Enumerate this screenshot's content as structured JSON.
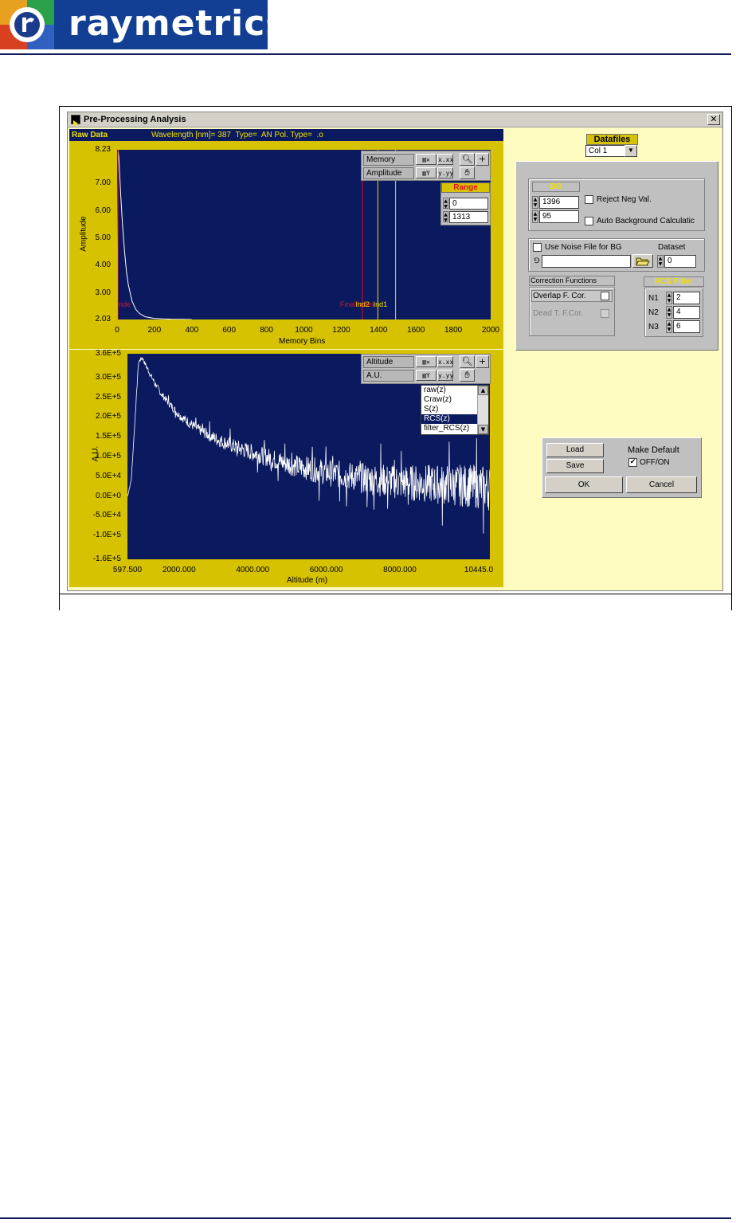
{
  "header": {
    "brand": "raymetrics"
  },
  "window": {
    "title": "Pre-Processing Analysis",
    "close_glyph": "✕"
  },
  "raw_graph": {
    "label": "Raw Data",
    "subtitle": "Wavelength [nm]= 387  Type=  AN Pol. Type=  .o",
    "scale_x_name": "Memory",
    "scale_y_name": "Amplitude",
    "x_format_glyph": "x.xx",
    "y_format_glyph": "y.yy",
    "range_label": "Range",
    "range_min": "0",
    "range_max": "1313",
    "marker_labels": [
      "nde",
      "Final Index",
      "Ind2",
      "Ind1"
    ]
  },
  "rcs_graph": {
    "scale_x_name": "Altitude",
    "scale_y_name": "A.U.",
    "x_format_glyph": "x.xx",
    "y_format_glyph": "y.yy",
    "function_list": [
      "raw(z)",
      "Craw(z)",
      "S(z)",
      "RCS(z)",
      "filter_RCS(z)"
    ],
    "function_selected": "RCS(z)"
  },
  "datafiles": {
    "label": "Datafiles",
    "value": "Col 1"
  },
  "bg": {
    "label": "BG",
    "value1": "1396",
    "value2": "95",
    "reject_neg_label": "Reject Neg Val.",
    "reject_neg_checked": false,
    "auto_bg_label": "Auto Background Calculatic",
    "auto_bg_checked": false
  },
  "noise": {
    "use_noise_label": "Use Noise File for BG",
    "use_noise_checked": false,
    "path_value": "",
    "path_icon": "path-icon",
    "browse_icon": "folder-open-icon",
    "dataset_label": "Dataset",
    "dataset_value": "0"
  },
  "correction": {
    "label": "Correction Functions",
    "overlap_label": "Overlap F. Cor.",
    "overlap_checked": false,
    "dead_time_label": "Dead T. F.Cor.",
    "dead_time_checked": false
  },
  "rcs_filter": {
    "label": "RCS Filter",
    "n1_label": "N1",
    "n1_value": "2",
    "n2_label": "N2",
    "n2_value": "4",
    "n3_label": "N3",
    "n3_value": "6"
  },
  "actions": {
    "load_label": "Load",
    "save_label": "Save",
    "make_default_label": "Make Default",
    "toggle_label": "OFF/ON",
    "toggle_checked": true,
    "ok_label": "OK",
    "cancel_label": "Cancel"
  },
  "icons": {
    "x_autoscale": "x-autoscale-icon",
    "y_autoscale": "y-autoscale-icon",
    "zoom": "zoom-icon",
    "cursor": "crosshair-icon",
    "pan": "hand-icon"
  },
  "colors": {
    "plot_bg": "#0b1a5e",
    "panel_yellow": "#d6c200",
    "window_bg": "#fdfbc0",
    "brand_blue": "#123f94",
    "marker_red": "#e01020",
    "marker_yellow": "#f0e000"
  },
  "chart_data": [
    {
      "type": "line",
      "title": "Raw Data",
      "xlabel": "Memory Bins",
      "ylabel": "Amplitude",
      "xlim": [
        0,
        2000
      ],
      "ylim": [
        2.03,
        8.23
      ],
      "x_ticks": [
        "0",
        "200",
        "400",
        "600",
        "800",
        "1000",
        "1200",
        "1400",
        "1600",
        "1800",
        "2000"
      ],
      "y_ticks": [
        "8.23",
        "7.00",
        "6.00",
        "5.00",
        "4.00",
        "3.00",
        "2.03"
      ],
      "series": [
        {
          "x": [
            0,
            5,
            10,
            15,
            20,
            30,
            40,
            50,
            60,
            80,
            100,
            120,
            150,
            200,
            250,
            300,
            350,
            400
          ],
          "y": [
            2.03,
            8.23,
            7.9,
            7.2,
            6.5,
            5.4,
            4.5,
            3.8,
            3.3,
            2.7,
            2.4,
            2.25,
            2.13,
            2.07,
            2.05,
            2.04,
            2.035,
            2.03
          ]
        }
      ],
      "markers": [
        {
          "label": "nde",
          "x": 0
        },
        {
          "label": "Final Index",
          "x": 1313
        },
        {
          "label": "Ind2",
          "x": 1396
        },
        {
          "label": "Ind1",
          "x": 1491
        }
      ]
    },
    {
      "type": "line",
      "xlabel": "Altitude (m)",
      "ylabel": "A.U.",
      "xlim": [
        597.5,
        10445
      ],
      "ylim": [
        -160000,
        360000
      ],
      "x_ticks": [
        "597.500",
        "2000.000",
        "4000.000",
        "6000.000",
        "8000.000",
        "10445.0"
      ],
      "y_ticks": [
        "3.6E+5",
        "3.0E+5",
        "2.5E+5",
        "2.0E+5",
        "1.5E+5",
        "1.0E+5",
        "5.0E+4",
        "0.0E+0",
        "-5.0E+4",
        "-1.0E+5",
        "-1.6E+5"
      ],
      "series": [
        {
          "x": [
            600,
            700,
            900,
            1000,
            1200,
            1500,
            2000,
            2500,
            3000,
            3500,
            4000,
            5000,
            6000,
            7000,
            8000,
            9000,
            10000,
            10445
          ],
          "y": [
            0,
            40000,
            340000,
            350000,
            310000,
            260000,
            205000,
            170000,
            145000,
            125000,
            110000,
            80000,
            60000,
            45000,
            35000,
            30000,
            25000,
            20000
          ]
        }
      ]
    }
  ]
}
